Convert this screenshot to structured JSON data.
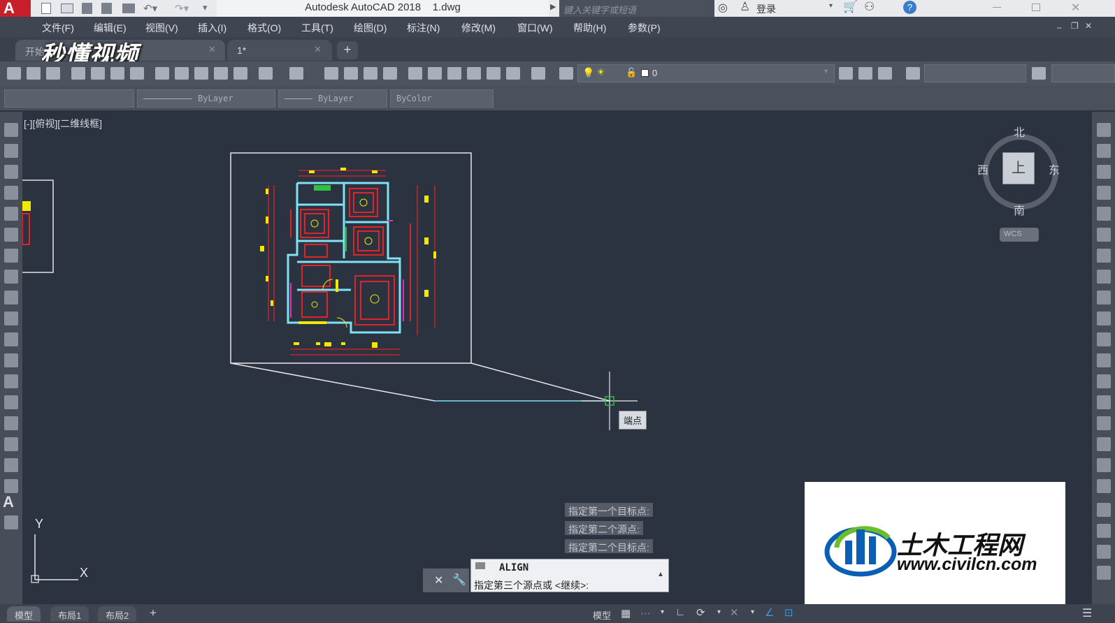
{
  "titlebar": {
    "app_title": "Autodesk AutoCAD 2018",
    "doc_name": "1.dwg",
    "search_placeholder": "键入关键字或短语",
    "login": "登录"
  },
  "menubar": {
    "items": [
      "文件(F)",
      "编辑(E)",
      "视图(V)",
      "插入(I)",
      "格式(O)",
      "工具(T)",
      "绘图(D)",
      "标注(N)",
      "修改(M)",
      "窗口(W)",
      "帮助(H)",
      "参数(P)"
    ]
  },
  "tabs": {
    "start": "开始",
    "doc": "1*",
    "add": "+"
  },
  "watermark_top": "秒懂视频",
  "toolbar": {
    "layer_value": "0"
  },
  "properties": {
    "color": "",
    "linetype": "ByLayer",
    "lineweight": "ByLayer",
    "plotstyle": "ByColor"
  },
  "viewport_label": "[-][俯视][二维线框]",
  "viewcube": {
    "north": "北",
    "south": "南",
    "east": "东",
    "west": "西",
    "face": "上",
    "wcs": "WCS"
  },
  "ucs": {
    "x": "X",
    "y": "Y"
  },
  "tooltip": "端点",
  "command": {
    "history": [
      "指定第一个目标点:",
      "指定第二个源点:",
      "指定第二个目标点:"
    ],
    "name": "ALIGN",
    "prompt": "指定第三个源点或 <继续>:"
  },
  "statusbar": {
    "tabs": [
      "模型",
      "布局1",
      "布局2"
    ],
    "add": "+",
    "model_label": "模型"
  },
  "watermark_brand": {
    "name": "土木工程网",
    "url": "www.civilcn.com"
  },
  "colors": {
    "canvas": "#2b3240",
    "cad_red": "#e0242a",
    "cad_yellow": "#f2e800",
    "cad_cyan": "#7fe3f5",
    "cad_magenta": "#e62eb4",
    "brand_blue": "#0a5fb4",
    "brand_green": "#6bbd2a"
  }
}
